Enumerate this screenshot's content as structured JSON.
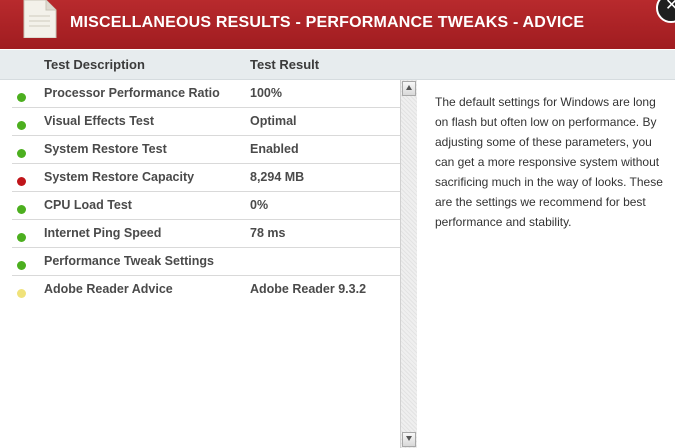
{
  "header": {
    "title": "MISCELLANEOUS RESULTS - PERFORMANCE TWEAKS - ADVICE",
    "icon": "document-icon",
    "close_glyph": "✕",
    "color": "#b82a2d"
  },
  "columns": {
    "description": "Test Description",
    "result": "Test Result"
  },
  "status_colors": {
    "ok": "#4caf1f",
    "critical": "#c0151a",
    "warning": "#f0e27a"
  },
  "results": [
    {
      "status": "ok",
      "description": "Processor Performance Ratio",
      "result": "100%"
    },
    {
      "status": "ok",
      "description": "Visual Effects Test",
      "result": "Optimal"
    },
    {
      "status": "ok",
      "description": "System Restore Test",
      "result": "Enabled"
    },
    {
      "status": "critical",
      "description": "System Restore Capacity",
      "result": "8,294 MB"
    },
    {
      "status": "ok",
      "description": "CPU Load Test",
      "result": "0%"
    },
    {
      "status": "ok",
      "description": "Internet Ping Speed",
      "result": "78 ms"
    },
    {
      "status": "ok",
      "description": "Performance Tweak Settings",
      "result": ""
    },
    {
      "status": "warning",
      "description": "Adobe Reader Advice",
      "result": "Adobe Reader 9.3.2"
    }
  ],
  "advice": {
    "text": "The default settings for Windows are long on flash but often low on performance. By adjusting some of these parameters, you can get a more responsive system without sacrificing much in the way of looks. These are the settings we recommend for best performance and stability."
  }
}
